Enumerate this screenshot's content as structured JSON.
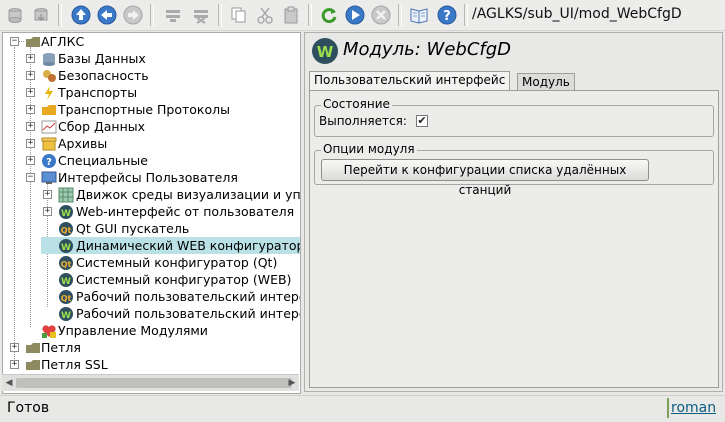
{
  "toolbar": {
    "path": "/AGLKS/sub_UI/mod_WebCfgD",
    "buttons": [
      {
        "icon": "db-load-icon"
      },
      {
        "icon": "db-save-icon"
      },
      {
        "icon": "up-arrow-icon"
      },
      {
        "icon": "back-arrow-icon"
      },
      {
        "icon": "forward-arrow-icon"
      },
      {
        "icon": "add-item-icon"
      },
      {
        "icon": "delete-item-icon"
      },
      {
        "icon": "copy-icon"
      },
      {
        "icon": "cut-icon"
      },
      {
        "icon": "paste-icon"
      },
      {
        "icon": "refresh-icon"
      },
      {
        "icon": "play-icon"
      },
      {
        "icon": "stop-icon"
      },
      {
        "icon": "manual-icon"
      },
      {
        "icon": "help-icon"
      }
    ]
  },
  "tree": {
    "items": [
      {
        "label": "АГЛКС"
      },
      {
        "label": "Базы Данных"
      },
      {
        "label": "Безопасность"
      },
      {
        "label": "Транспорты"
      },
      {
        "label": "Транспортные Протоколы"
      },
      {
        "label": "Сбор Данных"
      },
      {
        "label": "Архивы"
      },
      {
        "label": "Специальные"
      },
      {
        "label": "Интерфейсы Пользователя"
      },
      {
        "label": "Движок среды визуализации и упр"
      },
      {
        "label": "Web-интерфейс от пользователя"
      },
      {
        "label": "Qt GUI пускатель"
      },
      {
        "label": "Динамический WEB конфигуратор"
      },
      {
        "label": "Системный конфигуратор (Qt)"
      },
      {
        "label": "Системный конфигуратор (WEB)"
      },
      {
        "label": "Рабочий пользовательский интерф"
      },
      {
        "label": "Рабочий пользовательский интерф"
      },
      {
        "label": "Управление Модулями"
      },
      {
        "label": "Петля"
      },
      {
        "label": "Петля SSL"
      }
    ]
  },
  "module": {
    "title": "Модуль: WebCfgD",
    "tabs": [
      {
        "label": "Пользовательский интерфейс"
      },
      {
        "label": "Модуль"
      }
    ],
    "state_group": {
      "title": "Состояние",
      "running_label": "Выполняется:",
      "running": true
    },
    "options_group": {
      "title": "Опции модуля",
      "button_label": "Перейти к конфигурации списка удалённых станций"
    }
  },
  "status": {
    "text": "Готов",
    "user": "roman"
  },
  "colors": {
    "selection": "#b9e1e6",
    "toolbar_blue": "#3a78c8",
    "refresh_green": "#3a9a2a",
    "link": "#0c5c82"
  }
}
